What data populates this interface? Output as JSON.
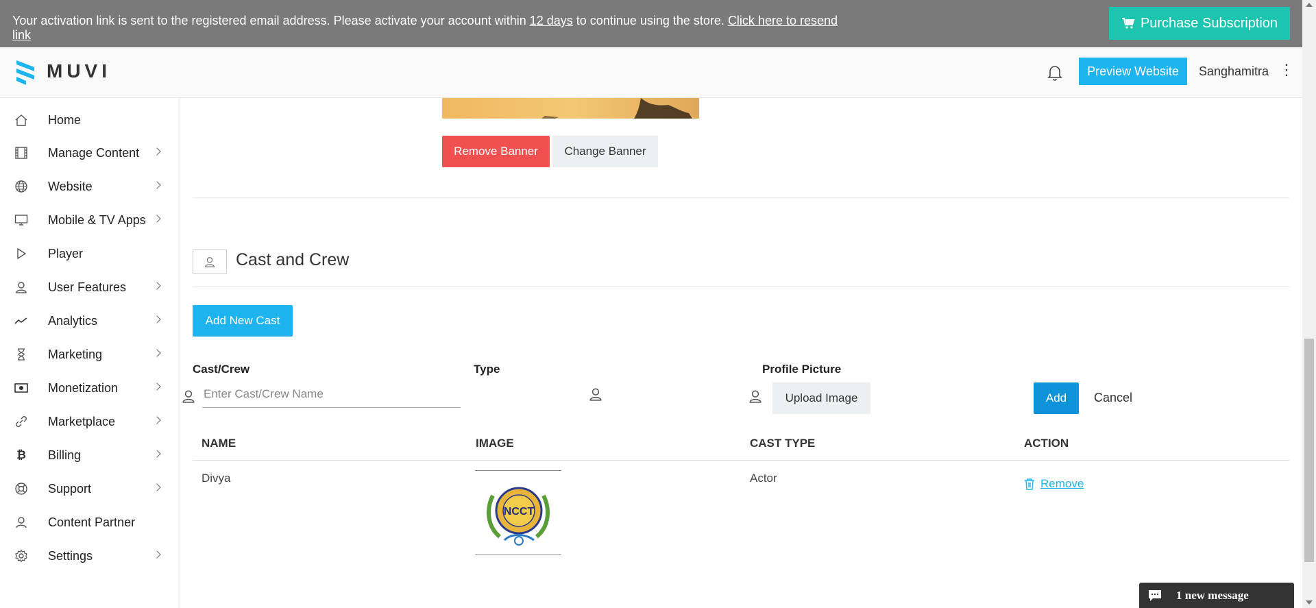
{
  "activation": {
    "text_before": "Your activation link is sent to the registered email address. Please activate your account within ",
    "days_link": "12 days",
    "text_after": " to continue using the store. ",
    "resend_link": "Click here to resend link",
    "purchase_label": "Purchase Subscription"
  },
  "header": {
    "logo_text": "MUVI",
    "preview_label": "Preview Website",
    "username": "Sanghamitra",
    "menu_glyph": "⋮"
  },
  "sidebar": {
    "items": [
      {
        "label": "Home",
        "icon": "home-icon",
        "has_children": false
      },
      {
        "label": "Manage Content",
        "icon": "film-icon",
        "has_children": true
      },
      {
        "label": "Website",
        "icon": "globe-icon",
        "has_children": true
      },
      {
        "label": "Mobile & TV Apps",
        "icon": "monitor-icon",
        "has_children": true
      },
      {
        "label": "Player",
        "icon": "play-icon",
        "has_children": false
      },
      {
        "label": "User Features",
        "icon": "user-icon",
        "has_children": true
      },
      {
        "label": "Analytics",
        "icon": "trend-icon",
        "has_children": true
      },
      {
        "label": "Marketing",
        "icon": "hourglass-icon",
        "has_children": true
      },
      {
        "label": "Monetization",
        "icon": "money-icon",
        "has_children": true
      },
      {
        "label": "Marketplace",
        "icon": "link-icon",
        "has_children": true
      },
      {
        "label": "Billing",
        "icon": "bitcoin-icon",
        "has_children": true
      },
      {
        "label": "Support",
        "icon": "lifebuoy-icon",
        "has_children": true
      },
      {
        "label": "Content Partner",
        "icon": "partner-icon",
        "has_children": false
      },
      {
        "label": "Settings",
        "icon": "gear-icon",
        "has_children": true
      }
    ]
  },
  "banner": {
    "remove_label": "Remove Banner",
    "change_label": "Change Banner"
  },
  "cast_section": {
    "title": "Cast and Crew",
    "add_new_label": "Add New Cast",
    "form": {
      "cast_label": "Cast/Crew",
      "cast_placeholder": "Enter Cast/Crew Name",
      "type_label": "Type",
      "picture_label": "Profile Picture",
      "upload_label": "Upload Image",
      "add_label": "Add",
      "cancel_label": "Cancel"
    },
    "table": {
      "headers": [
        "NAME",
        "IMAGE",
        "CAST TYPE",
        "ACTION"
      ],
      "rows": [
        {
          "name": "Divya",
          "image_text": "NCCT",
          "cast_type": "Actor",
          "action": "Remove"
        }
      ]
    }
  },
  "chat": {
    "label": "1 new message"
  },
  "colors": {
    "accent": "#1eb4ef",
    "danger": "#f05050",
    "teal": "#1bc5b0",
    "add_button": "#0e93d8"
  }
}
